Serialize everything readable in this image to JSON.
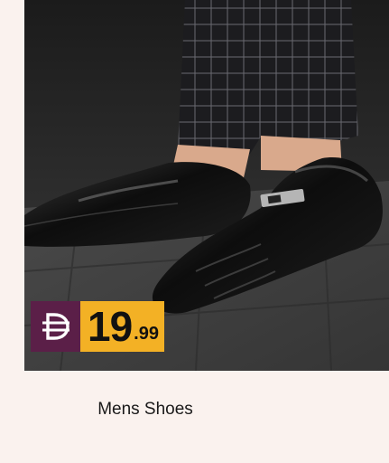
{
  "product": {
    "name": "Mens Shoes",
    "image_alt": "Black leather slip-on dress shoes",
    "price": {
      "currency_icon": "dirham-icon",
      "integer": "19",
      "decimal": ".99"
    }
  },
  "colors": {
    "background": "#faf2ee",
    "currency_badge": "#5b1f48",
    "price_badge": "#f3b125"
  }
}
